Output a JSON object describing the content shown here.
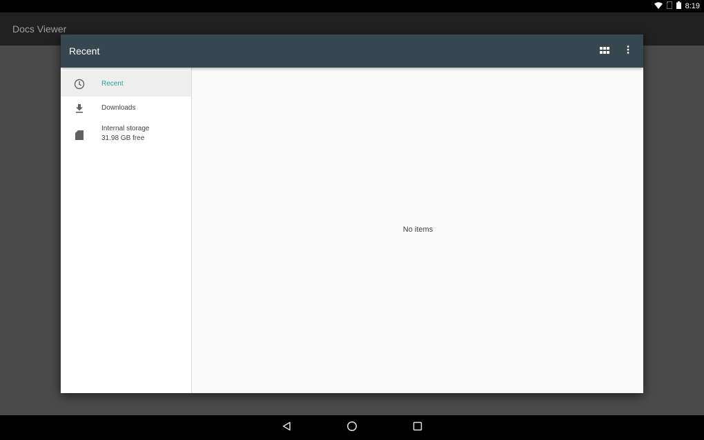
{
  "status_bar": {
    "time": "8:19",
    "icons": [
      "wifi-icon",
      "sim-icon",
      "battery-icon"
    ]
  },
  "app_bar": {
    "title": "Docs Viewer"
  },
  "dialog": {
    "title": "Recent",
    "actions": [
      "grid-view-icon",
      "more-vert-icon"
    ],
    "drawer": {
      "items": [
        {
          "icon": "clock-icon",
          "label": "Recent",
          "active": true
        },
        {
          "icon": "download-icon",
          "label": "Downloads",
          "active": false
        },
        {
          "icon": "sd-card-icon",
          "label": "Internal storage",
          "sublabel": "31.98 GB free",
          "active": false
        }
      ]
    },
    "content": {
      "empty_text": "No items"
    }
  },
  "nav_bar": {
    "buttons": [
      "back-icon",
      "home-icon",
      "recents-icon"
    ]
  },
  "colors": {
    "toolbar": "#37474f",
    "accent": "#26a69a",
    "app_bar": "#212121",
    "backdrop": "#4a4a4a"
  }
}
